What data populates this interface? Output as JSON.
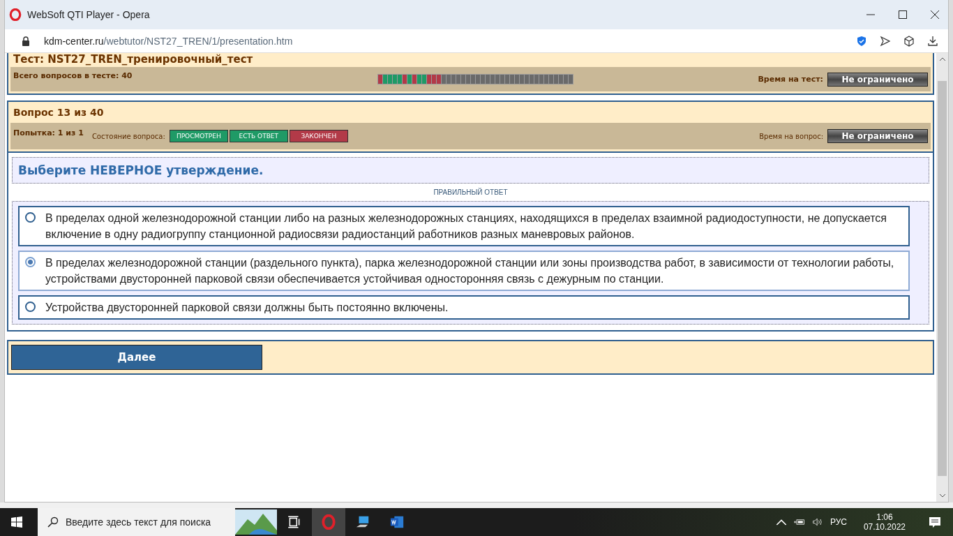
{
  "window": {
    "title": "WebSoft QTI Player - Opera"
  },
  "address_bar": {
    "domain": "kdm-center.ru",
    "path": "/webtutor/NST27_TREN/1/presentation.htm"
  },
  "test_header": {
    "title": "Тест: NST27_TREN_тренировочный_тест",
    "total_label": "Всего вопросов в тесте: 40",
    "time_label": "Время на тест:",
    "time_value": "Не ограничено",
    "progress": [
      {
        "color": "#b23a48"
      },
      {
        "color": "#1f9a66"
      },
      {
        "color": "#1f9a66"
      },
      {
        "color": "#1f9a66"
      },
      {
        "color": "#1f9a66"
      },
      {
        "color": "#b23a48"
      },
      {
        "color": "#1f9a66"
      },
      {
        "color": "#b23a48"
      },
      {
        "color": "#1f9a66"
      },
      {
        "color": "#1f9a66"
      },
      {
        "color": "#b23a48"
      },
      {
        "color": "#b23a48"
      },
      {
        "color": "#b23a48"
      },
      {
        "color": "#6a6a6a"
      },
      {
        "color": "#6a6a6a"
      },
      {
        "color": "#6a6a6a"
      },
      {
        "color": "#6a6a6a"
      },
      {
        "color": "#6a6a6a"
      },
      {
        "color": "#6a6a6a"
      },
      {
        "color": "#6a6a6a"
      },
      {
        "color": "#6a6a6a"
      },
      {
        "color": "#6a6a6a"
      },
      {
        "color": "#6a6a6a"
      },
      {
        "color": "#6a6a6a"
      },
      {
        "color": "#6a6a6a"
      },
      {
        "color": "#6a6a6a"
      },
      {
        "color": "#6a6a6a"
      },
      {
        "color": "#6a6a6a"
      },
      {
        "color": "#6a6a6a"
      },
      {
        "color": "#6a6a6a"
      },
      {
        "color": "#6a6a6a"
      },
      {
        "color": "#6a6a6a"
      },
      {
        "color": "#6a6a6a"
      },
      {
        "color": "#6a6a6a"
      },
      {
        "color": "#6a6a6a"
      },
      {
        "color": "#6a6a6a"
      },
      {
        "color": "#6a6a6a"
      },
      {
        "color": "#6a6a6a"
      },
      {
        "color": "#6a6a6a"
      },
      {
        "color": "#6a6a6a"
      }
    ]
  },
  "question_header": {
    "title": "Вопрос 13 из 40",
    "attempt": "Попытка: 1 из 1",
    "state_label": "Состояние вопроса:",
    "states": [
      {
        "label": "ПРОСМОТРЕН",
        "color": "#1f9a66"
      },
      {
        "label": "ЕСТЬ ОТВЕТ",
        "color": "#1f9a66"
      },
      {
        "label": "ЗАКОНЧЕН",
        "color": "#b23a48"
      }
    ],
    "time_label": "Время на вопрос:",
    "time_value": "Не ограничено"
  },
  "question": {
    "prompt": "Выберите НЕВЕРНОЕ утверждение.",
    "answer_label": "ПРАВИЛЬНЫЙ ОТВЕТ",
    "options": [
      {
        "text": "В пределах одной железнодорожной станции либо на разных железнодорожных станциях, находящихся в пределах взаимной радиодоступности, не допускается включение в одну радиогруппу станционной радиосвязи радиостанций работников разных маневровых районов.",
        "selected": false
      },
      {
        "text": "В пределах железнодорожной станции (раздельного пункта), парка железнодорожной станции или зоны производства работ, в зависимости от технологии работы, устройствами двусторонней парковой связи обеспечивается устойчивая односторонняя связь с дежурным по станции.",
        "selected": true
      },
      {
        "text": "Устройства двусторонней парковой связи должны быть постоянно включены.",
        "selected": false
      }
    ]
  },
  "next_button": "Далее",
  "taskbar": {
    "search_placeholder": "Введите здесь текст для поиска",
    "language": "РУС",
    "time": "1:06",
    "date": "07.10.2022"
  }
}
